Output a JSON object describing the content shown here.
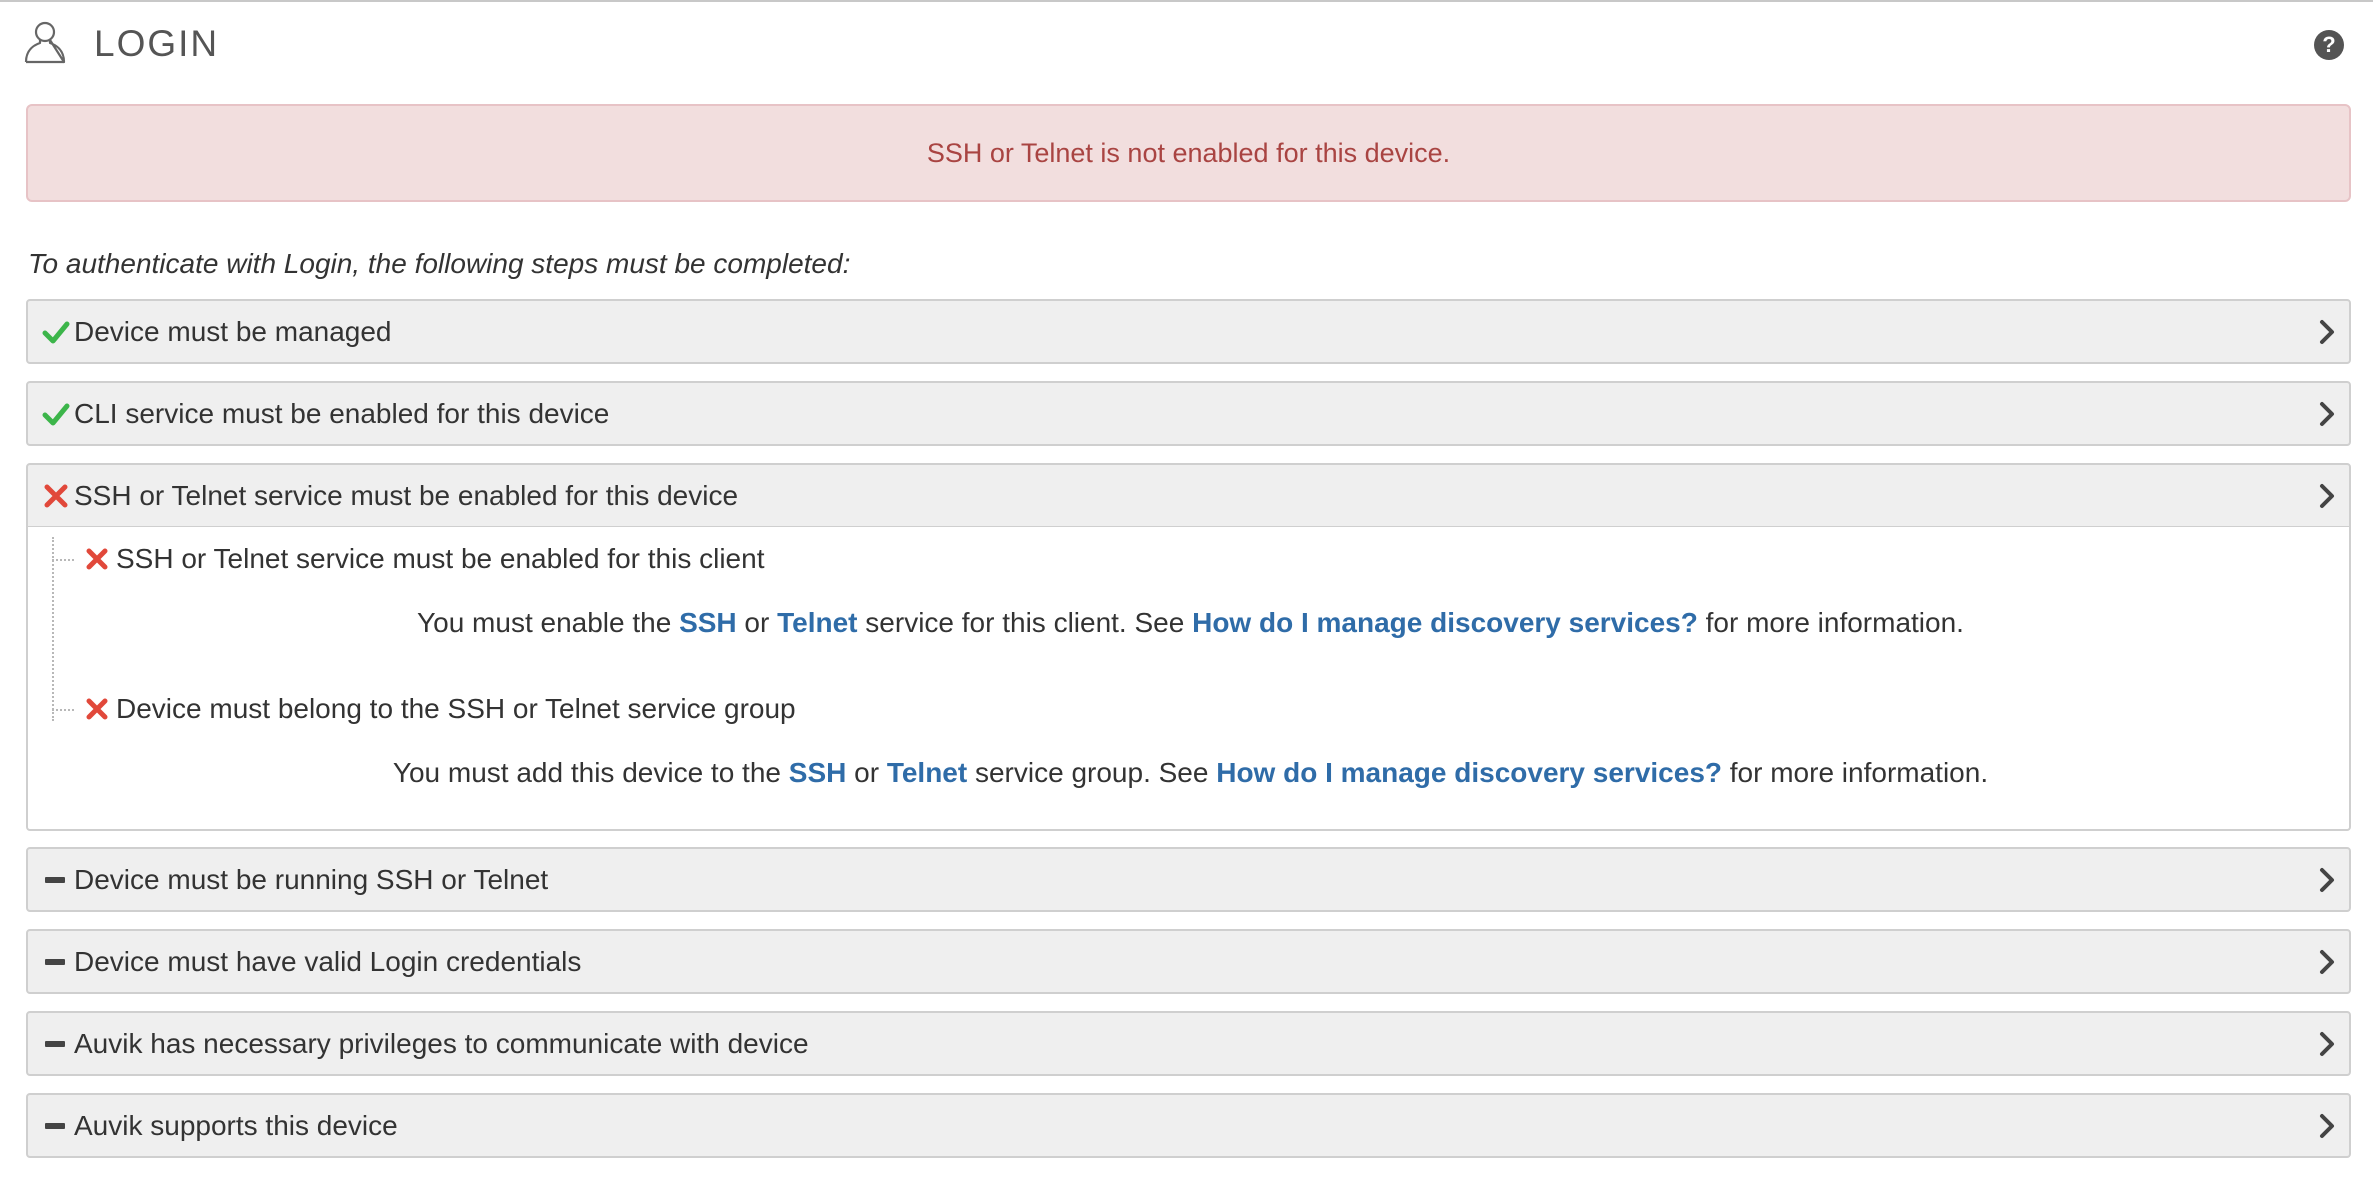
{
  "header": {
    "title": "LOGIN",
    "help_label": "?"
  },
  "alert": {
    "text": "SSH or Telnet is not enabled for this device."
  },
  "intro": "To authenticate with Login, the following steps must be completed:",
  "steps": [
    {
      "label": "Device must be managed",
      "status": "check"
    },
    {
      "label": "CLI service must be enabled for this device",
      "status": "check"
    },
    {
      "label": "SSH or Telnet service must be enabled for this device",
      "status": "fail"
    },
    {
      "label": "Device must be running SSH or Telnet",
      "status": "pending"
    },
    {
      "label": "Device must have valid Login credentials",
      "status": "pending"
    },
    {
      "label": "Auvik has necessary privileges to communicate with device",
      "status": "pending"
    },
    {
      "label": "Auvik supports this device",
      "status": "pending"
    }
  ],
  "substeps": [
    {
      "label": "SSH or Telnet service must be enabled for this client",
      "status": "fail",
      "msg": {
        "pre": "You must enable the ",
        "link1": "SSH",
        "mid1": " or ",
        "link2": "Telnet",
        "mid2": " service for this client. See ",
        "help_link": "How do I manage discovery services?",
        "post": " for more information."
      }
    },
    {
      "label": "Device must belong to the SSH or Telnet service group",
      "status": "fail",
      "msg": {
        "pre": "You must add this device to the ",
        "link1": "SSH",
        "mid1": " or ",
        "link2": "Telnet",
        "mid2": " service group. See ",
        "help_link": "How do I manage discovery services?",
        "post": " for more information."
      }
    }
  ],
  "colors": {
    "check": "#3cb54a",
    "fail": "#e1483a",
    "pending": "#444444",
    "link": "#2f6ca8",
    "alert_text": "#a94442",
    "alert_bg": "#f2dede"
  },
  "icons": {
    "header": "user-icon",
    "help": "help-icon",
    "check": "check-icon",
    "fail": "x-icon",
    "pending": "dash-icon",
    "chevron": "chevron-right-icon"
  }
}
